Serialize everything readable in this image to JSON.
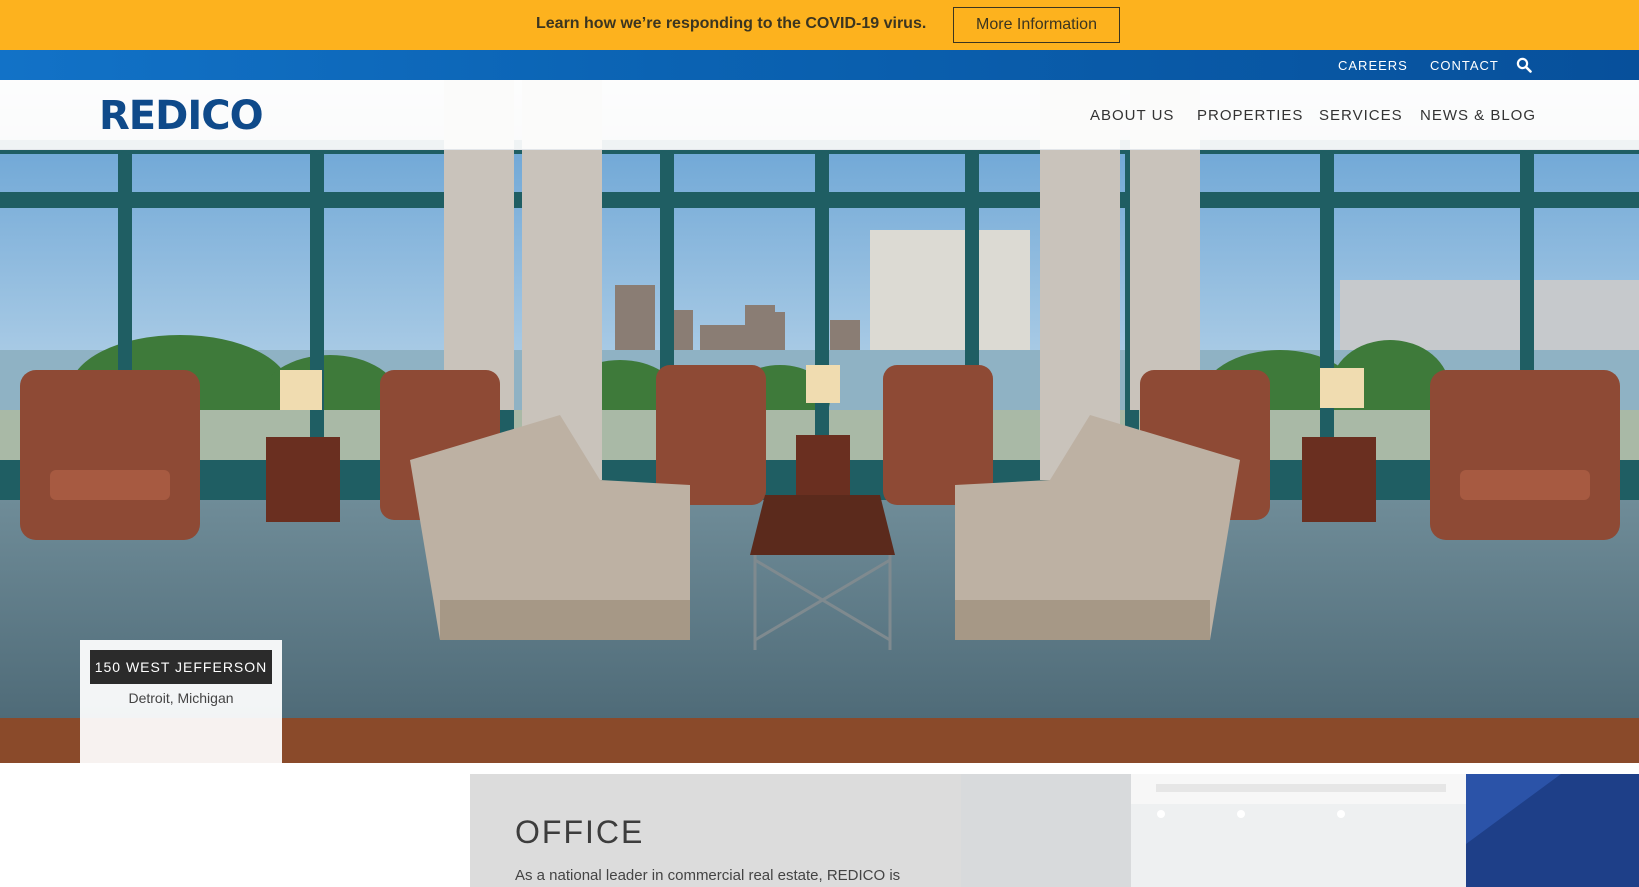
{
  "covid_banner": {
    "text": "Learn how we’re responding to the COVID-19 virus.",
    "button_label": "More Information"
  },
  "utility_nav": {
    "items": [
      "CAREERS",
      "CONTACT"
    ],
    "search_icon": "search-icon"
  },
  "header": {
    "logo_text": "REDICO",
    "nav": [
      "ABOUT US",
      "PROPERTIES",
      "SERVICES",
      "NEWS & BLOG"
    ]
  },
  "hero": {
    "property_name": "150 WEST JEFFERSON",
    "property_location": "Detroit, Michigan"
  },
  "office_section": {
    "title": "OFFICE",
    "text": "As a national leader in commercial real estate, REDICO is"
  },
  "colors": {
    "banner": "#fdb21e",
    "utility_bar": "#0b63b3",
    "logo": "#0f4a8a",
    "caption_tag": "#2b2b2b"
  }
}
